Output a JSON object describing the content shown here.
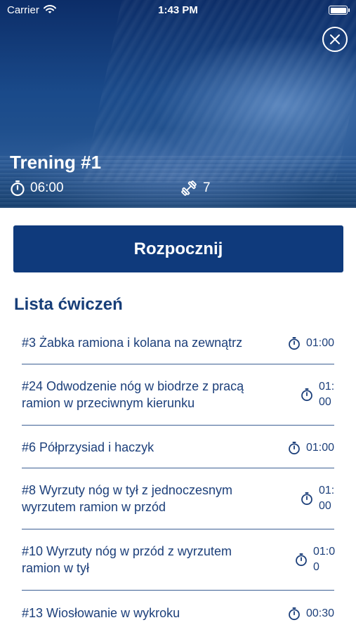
{
  "status_bar": {
    "carrier": "Carrier",
    "time": "1:43 PM"
  },
  "icons": {
    "close": "close-icon",
    "timer": "stopwatch-icon",
    "equipment": "dumbbell-icon",
    "wifi": "wifi-icon",
    "battery": "battery-icon"
  },
  "workout": {
    "title": "Trening #1",
    "duration": "06:00",
    "exercise_count": "7"
  },
  "start_button": {
    "label": "Rozpocznij"
  },
  "exercise_list": {
    "title": "Lista ćwiczeń",
    "items": [
      {
        "name_line1": "#3 Żabka ramiona i kolana na zewnątrz",
        "name_line2": "",
        "time_line1": "01:00",
        "time_line2": ""
      },
      {
        "name_line1": "#24 Odwodzenie nóg w biodrze z pracą",
        "name_line2": "ramion w przeciwnym kierunku",
        "time_line1": "01:",
        "time_line2": "00"
      },
      {
        "name_line1": "#6 Półprzysiad i haczyk",
        "name_line2": "",
        "time_line1": "01:00",
        "time_line2": ""
      },
      {
        "name_line1": "#8 Wyrzuty nóg w tył z jednoczesnym",
        "name_line2": "wyrzutem ramion w przód",
        "time_line1": "01:",
        "time_line2": "00"
      },
      {
        "name_line1": "#10 Wyrzuty nóg w przód z wyrzutem",
        "name_line2": "ramion w tył",
        "time_line1": "01:0",
        "time_line2": "0"
      },
      {
        "name_line1": "#13 Wiosłowanie w wykroku",
        "name_line2": "",
        "time_line1": "00:30",
        "time_line2": ""
      }
    ]
  },
  "colors": {
    "primary": "#0f3a7c",
    "text": "#1c3f7a",
    "divider": "#3c5f94",
    "background": "#ffffff"
  }
}
